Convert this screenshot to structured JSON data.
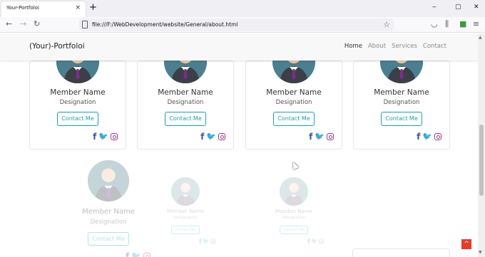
{
  "browser": {
    "tab_title": "Your-Portfoloi",
    "tab_close": "×",
    "new_tab": "+",
    "window_buttons": [
      "‒",
      "▢",
      "✕"
    ],
    "url": "file:///F:/WebDevelopment/website/General/about.html",
    "nav_icons": [
      "back-icon",
      "forward-icon",
      "reload-icon"
    ],
    "toolbar_icons": [
      "pocket-icon",
      "library-icon",
      "extension-icon",
      "menu-icon"
    ]
  },
  "site": {
    "brand": "(Your)-Portfoloi",
    "menu": [
      {
        "label": "Home",
        "active": true
      },
      {
        "label": "About",
        "active": false
      },
      {
        "label": "Services",
        "active": false
      },
      {
        "label": "Contact",
        "active": false
      }
    ]
  },
  "team_row_1": [
    {
      "name": "Member Name",
      "designation": "Designation",
      "button": "Contact Me"
    },
    {
      "name": "Member Name",
      "designation": "Designation",
      "button": "Contact Me"
    },
    {
      "name": "Member Name",
      "designation": "Designation",
      "button": "Contact Me"
    },
    {
      "name": "Member Name",
      "designation": "Designation",
      "button": "Contact Me"
    }
  ],
  "team_row_2": [
    {
      "name": "Member Name",
      "designation": "Designation",
      "button": "Contact Me"
    },
    {
      "name": "Member Name",
      "designation": "Designation",
      "button": "Contact Me"
    },
    {
      "name": "Member Name",
      "designation": "Designation",
      "button": "Contact Me"
    }
  ],
  "scroll_top_icon": "^",
  "colors": {
    "accent": "#17a2b8",
    "facebook": "#3b5998",
    "twitter": "#1da1f2",
    "instagram": "#a1368f",
    "scroll_top": "#e63c2e",
    "avatar_bg": "#4b7f8f",
    "tie": "#7b2d8b"
  }
}
